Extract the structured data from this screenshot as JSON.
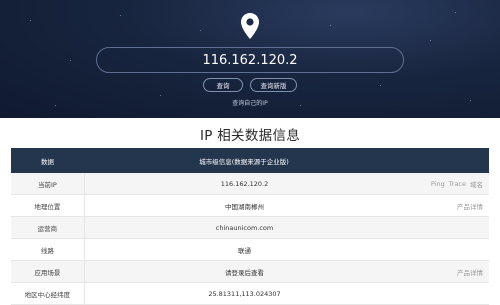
{
  "search": {
    "ip_value": "116.162.120.2",
    "query_button": "查询",
    "query_new_button": "查询新版",
    "self_link": "查询自己的IP"
  },
  "section": {
    "title": "IP 相关数据信息"
  },
  "table": {
    "headers": [
      "数据",
      "城市级信息(数据来源于企业版)"
    ],
    "rows": [
      {
        "label": "当前IP",
        "value": "116.162.120.2",
        "actions": [
          "Ping",
          "Trace",
          "域名"
        ]
      },
      {
        "label": "地理位置",
        "value": "中国湖南郴州",
        "actions": [
          "产品详情"
        ]
      },
      {
        "label": "运营商",
        "value": "chinaunicom.com",
        "actions": []
      },
      {
        "label": "线路",
        "value": "联通",
        "actions": []
      },
      {
        "label": "应用场景",
        "value": "请登录后查看",
        "actions": [
          "产品详情"
        ]
      },
      {
        "label": "地区中心经纬度",
        "value": "25.81311,113.024307",
        "actions": []
      }
    ]
  },
  "colors": {
    "hero_bg": "#18253f",
    "table_header": "#24364d"
  }
}
